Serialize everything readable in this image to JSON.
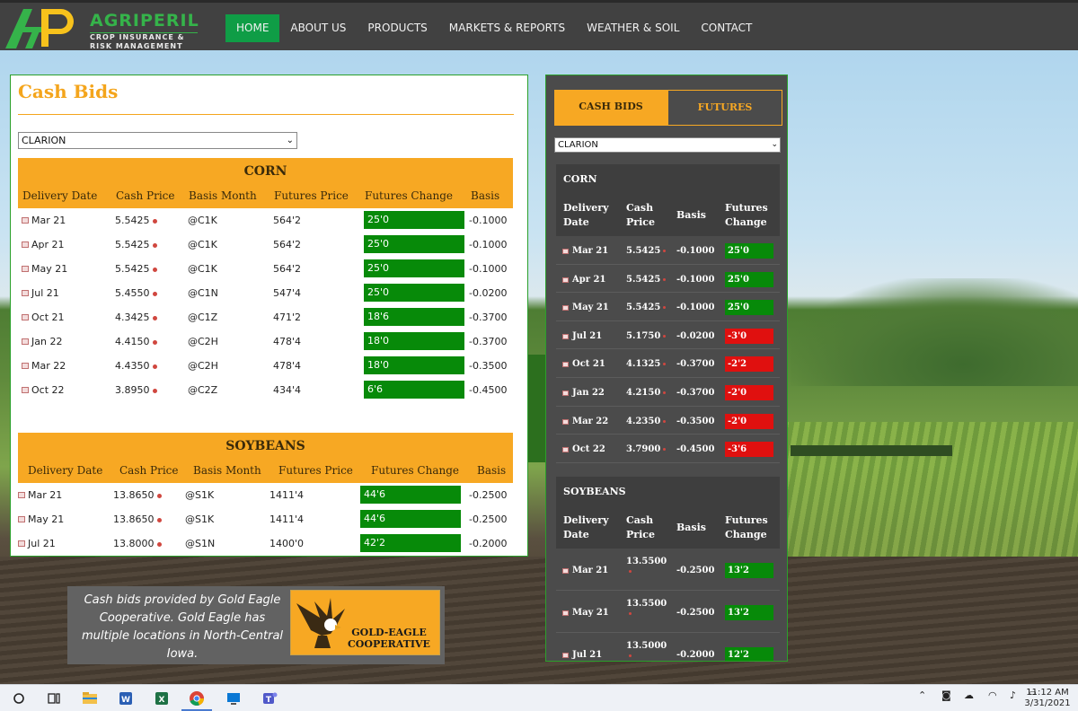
{
  "header": {
    "brand": "AGRIPERIL",
    "tagline_line1": "CROP INSURANCE &",
    "tagline_line2": "RISK MANAGEMENT",
    "nav": [
      {
        "label": "HOME",
        "active": true
      },
      {
        "label": "ABOUT US"
      },
      {
        "label": "PRODUCTS"
      },
      {
        "label": "MARKETS & REPORTS"
      },
      {
        "label": "WEATHER & SOIL"
      },
      {
        "label": "CONTACT"
      }
    ]
  },
  "cash_bids": {
    "title": "Cash Bids",
    "location_select": "CLARION",
    "corn": {
      "name": "CORN",
      "columns": [
        "Delivery Date",
        "Cash Price",
        "Basis Month",
        "Futures Price",
        "Futures Change",
        "Basis"
      ],
      "rows": [
        {
          "date": "Mar 21",
          "cash": "5.5425",
          "basis_month": "@C1K",
          "futures": "564'2",
          "change": "25'0",
          "basis": "-0.1000"
        },
        {
          "date": "Apr 21",
          "cash": "5.5425",
          "basis_month": "@C1K",
          "futures": "564'2",
          "change": "25'0",
          "basis": "-0.1000"
        },
        {
          "date": "May 21",
          "cash": "5.5425",
          "basis_month": "@C1K",
          "futures": "564'2",
          "change": "25'0",
          "basis": "-0.1000"
        },
        {
          "date": "Jul 21",
          "cash": "5.4550",
          "basis_month": "@C1N",
          "futures": "547'4",
          "change": "25'0",
          "basis": "-0.0200"
        },
        {
          "date": "Oct 21",
          "cash": "4.3425",
          "basis_month": "@C1Z",
          "futures": "471'2",
          "change": "18'6",
          "basis": "-0.3700"
        },
        {
          "date": "Jan 22",
          "cash": "4.4150",
          "basis_month": "@C2H",
          "futures": "478'4",
          "change": "18'0",
          "basis": "-0.3700"
        },
        {
          "date": "Mar 22",
          "cash": "4.4350",
          "basis_month": "@C2H",
          "futures": "478'4",
          "change": "18'0",
          "basis": "-0.3500"
        },
        {
          "date": "Oct 22",
          "cash": "3.8950",
          "basis_month": "@C2Z",
          "futures": "434'4",
          "change": "6'6",
          "basis": "-0.4500"
        }
      ]
    },
    "soybeans": {
      "name": "SOYBEANS",
      "columns": [
        "Delivery Date",
        "Cash Price",
        "Basis Month",
        "Futures Price",
        "Futures Change",
        "Basis"
      ],
      "rows": [
        {
          "date": "Mar 21",
          "cash": "13.8650",
          "basis_month": "@S1K",
          "futures": "1411'4",
          "change": "44'6",
          "basis": "-0.2500"
        },
        {
          "date": "May 21",
          "cash": "13.8650",
          "basis_month": "@S1K",
          "futures": "1411'4",
          "change": "44'6",
          "basis": "-0.2500"
        },
        {
          "date": "Jul 21",
          "cash": "13.8000",
          "basis_month": "@S1N",
          "futures": "1400'0",
          "change": "42'2",
          "basis": "-0.2000"
        }
      ]
    }
  },
  "notice": {
    "text": "Cash bids provided by Gold Eagle Cooperative. Gold Eagle has multiple locations in North-Central Iowa.",
    "logo_line1": "GOLD-EAGLE",
    "logo_line2": "COOPERATIVE"
  },
  "widget": {
    "tabs": [
      {
        "label": "CASH BIDS",
        "active": true
      },
      {
        "label": "FUTURES"
      }
    ],
    "location_select": "CLARION",
    "corn": {
      "name": "CORN",
      "col_delivery_1": "Delivery",
      "col_delivery_2": "Date",
      "col_cash_1": "Cash",
      "col_cash_2": "Price",
      "col_basis": "Basis",
      "col_change_1": "Futures",
      "col_change_2": "Change",
      "rows": [
        {
          "date": "Mar 21",
          "cash": "5.5425",
          "basis": "-0.1000",
          "change": "25'0",
          "direction": "up"
        },
        {
          "date": "Apr 21",
          "cash": "5.5425",
          "basis": "-0.1000",
          "change": "25'0",
          "direction": "up"
        },
        {
          "date": "May 21",
          "cash": "5.5425",
          "basis": "-0.1000",
          "change": "25'0",
          "direction": "up"
        },
        {
          "date": "Jul 21",
          "cash": "5.1750",
          "basis": "-0.0200",
          "change": "-3'0",
          "direction": "down"
        },
        {
          "date": "Oct 21",
          "cash": "4.1325",
          "basis": "-0.3700",
          "change": "-2'2",
          "direction": "down"
        },
        {
          "date": "Jan 22",
          "cash": "4.2150",
          "basis": "-0.3700",
          "change": "-2'0",
          "direction": "down"
        },
        {
          "date": "Mar 22",
          "cash": "4.2350",
          "basis": "-0.3500",
          "change": "-2'0",
          "direction": "down"
        },
        {
          "date": "Oct 22",
          "cash": "3.7900",
          "basis": "-0.4500",
          "change": "-3'6",
          "direction": "down"
        }
      ]
    },
    "soybeans": {
      "name": "SOYBEANS",
      "col_delivery_1": "Delivery",
      "col_delivery_2": "Date",
      "col_cash_1": "Cash",
      "col_cash_2": "Price",
      "col_basis": "Basis",
      "col_change_1": "Futures",
      "col_change_2": "Change",
      "rows": [
        {
          "date": "Mar 21",
          "cash": "13.5500",
          "basis": "-0.2500",
          "change": "13'2",
          "direction": "up"
        },
        {
          "date": "May 21",
          "cash": "13.5500",
          "basis": "-0.2500",
          "change": "13'2",
          "direction": "up"
        },
        {
          "date": "Jul 21",
          "cash": "13.5000",
          "basis": "-0.2000",
          "change": "12'2",
          "direction": "up"
        }
      ]
    }
  },
  "taskbar": {
    "apps": [
      "search-icon",
      "task-view-icon",
      "file-explorer-icon",
      "word-icon",
      "excel-icon",
      "chrome-icon",
      "remote-desktop-icon",
      "teams-icon"
    ],
    "tray": [
      "chevron-up-icon",
      "meet-now-icon",
      "onedrive-icon",
      "wifi-icon",
      "volume-icon",
      "keyboard-icon"
    ],
    "time": "11:12 AM",
    "date": "3/31/2021"
  },
  "colors": {
    "accent_orange": "#f7a823",
    "brand_green": "#35b34a",
    "nav_active": "#0f9d46",
    "positive_change": "#078a09",
    "negative_change": "#e0100f"
  }
}
